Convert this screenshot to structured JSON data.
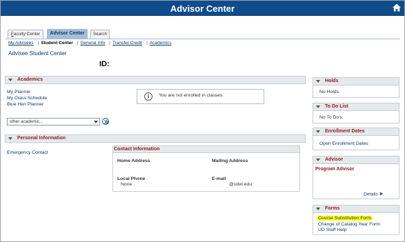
{
  "app": {
    "title": "Advisor Center"
  },
  "tabs": [
    {
      "label": "Faculty Center",
      "accel": "F",
      "active": false
    },
    {
      "label": "Advisor Center",
      "accel": "",
      "active": true
    },
    {
      "label": "Search",
      "accel": "",
      "active": false
    }
  ],
  "subnav": [
    {
      "label": "My Advisees",
      "current": false
    },
    {
      "label": "Student Center",
      "current": true
    },
    {
      "label": "General Info",
      "current": false
    },
    {
      "label": "Transfer Credit",
      "current": false
    },
    {
      "label": "Academics",
      "current": false
    }
  ],
  "page": {
    "title": "Advisee Student Center",
    "id_label": "ID:"
  },
  "academics": {
    "header": "Academics",
    "links": [
      "My Planner",
      "My Class Schedule",
      "Blue Hen Planner"
    ],
    "notice": "You are not enrolled in classes.",
    "select_value": "other academic..."
  },
  "personal": {
    "header": "Personal Information",
    "emergency_contact": "Emergency Contact",
    "contact_header": "Contact Information",
    "home_address_label": "Home Address",
    "mailing_address_label": "Mailing Address",
    "local_phone_label": "Local Phone",
    "local_phone_value": "None",
    "email_label": "E-mail",
    "email_value": "@udel.edu"
  },
  "sidebar": {
    "holds": {
      "header": "Holds",
      "text": "No Holds."
    },
    "todo": {
      "header": "To Do List",
      "text": "No To Do's."
    },
    "enrollment": {
      "header": "Enrollment Dates",
      "link": "Open Enrollment Dates"
    },
    "advisor": {
      "header": "Advisor",
      "title": "Program Advisor",
      "details": "Details"
    },
    "forms": {
      "header": "Forms",
      "items": [
        "Course Substitution Form",
        "Change of Catalog Year Form",
        "UD Staff Help"
      ]
    }
  },
  "colors": {
    "title_bar": "#104c8c",
    "section_header_text": "#8a1c1c",
    "link": "#0b3a6a",
    "highlight": "#ffff00"
  }
}
